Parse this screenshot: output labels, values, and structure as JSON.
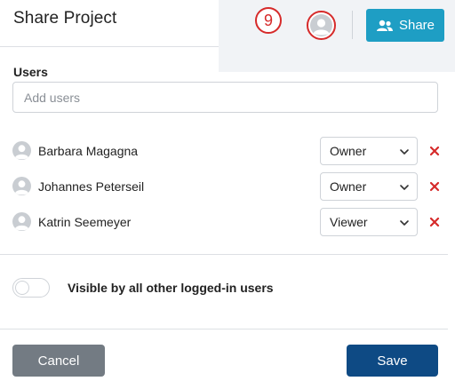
{
  "dialog": {
    "title": "Share Project"
  },
  "toolbar": {
    "step_badge": "9",
    "share_label": "Share",
    "share_icon": "users-icon",
    "avatar_icon": "user-avatar-icon"
  },
  "users": {
    "label": "Users",
    "add_placeholder": "Add users",
    "add_value": "",
    "list": [
      {
        "name": "Barbara Magagna",
        "role": "Owner"
      },
      {
        "name": "Johannes Peterseil",
        "role": "Owner"
      },
      {
        "name": "Katrin Seemeyer",
        "role": "Viewer"
      }
    ],
    "remove_icon": "close-icon",
    "select_icon": "chevron-down-icon"
  },
  "visibility": {
    "label": "Visible by all other logged-in users",
    "enabled": false
  },
  "footer": {
    "cancel_label": "Cancel",
    "save_label": "Save"
  },
  "colors": {
    "share_button": "#1e9ec4",
    "save_button": "#0e4a84",
    "cancel_button": "#737b83",
    "remove_icon": "#d62a2a",
    "annotation": "#d62a2a"
  }
}
